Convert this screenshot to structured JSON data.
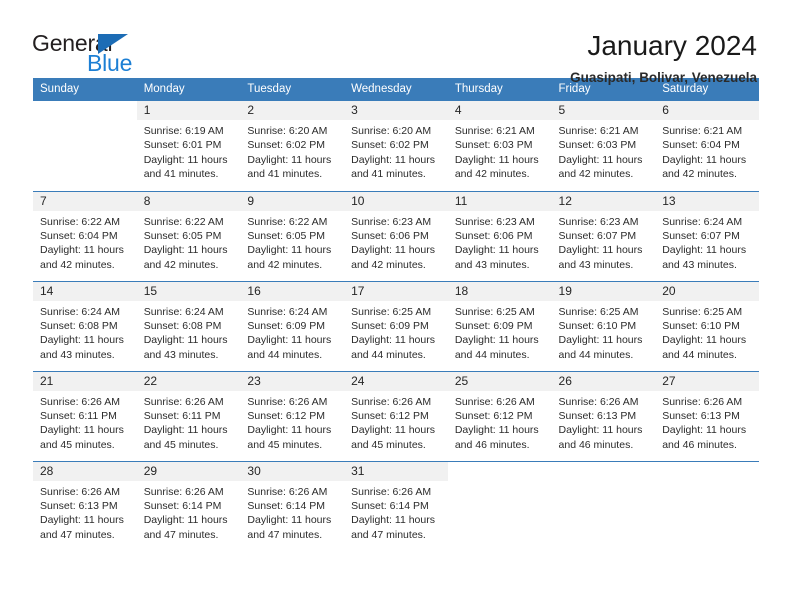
{
  "brand": {
    "name_top": "General",
    "name_bottom": "Blue",
    "triangle_color": "#1c6cb5",
    "blue_color": "#1c7fd4"
  },
  "header": {
    "title": "January 2024",
    "subtitle": "Guasipati, Bolivar, Venezuela"
  },
  "theme": {
    "header_bg": "#3a7cb9",
    "header_text": "#ffffff",
    "daynum_band_bg": "#f1f1f1",
    "row_separator": "#3a7cb9",
    "body_text": "#2b2b2b"
  },
  "calendar": {
    "weekday_headers": [
      "Sunday",
      "Monday",
      "Tuesday",
      "Wednesday",
      "Thursday",
      "Friday",
      "Saturday"
    ],
    "weeks": [
      [
        {
          "day": "",
          "sunrise": "",
          "sunset": "",
          "daylight_line1": "",
          "daylight_line2": ""
        },
        {
          "day": "1",
          "sunrise": "Sunrise: 6:19 AM",
          "sunset": "Sunset: 6:01 PM",
          "daylight_line1": "Daylight: 11 hours",
          "daylight_line2": "and 41 minutes."
        },
        {
          "day": "2",
          "sunrise": "Sunrise: 6:20 AM",
          "sunset": "Sunset: 6:02 PM",
          "daylight_line1": "Daylight: 11 hours",
          "daylight_line2": "and 41 minutes."
        },
        {
          "day": "3",
          "sunrise": "Sunrise: 6:20 AM",
          "sunset": "Sunset: 6:02 PM",
          "daylight_line1": "Daylight: 11 hours",
          "daylight_line2": "and 41 minutes."
        },
        {
          "day": "4",
          "sunrise": "Sunrise: 6:21 AM",
          "sunset": "Sunset: 6:03 PM",
          "daylight_line1": "Daylight: 11 hours",
          "daylight_line2": "and 42 minutes."
        },
        {
          "day": "5",
          "sunrise": "Sunrise: 6:21 AM",
          "sunset": "Sunset: 6:03 PM",
          "daylight_line1": "Daylight: 11 hours",
          "daylight_line2": "and 42 minutes."
        },
        {
          "day": "6",
          "sunrise": "Sunrise: 6:21 AM",
          "sunset": "Sunset: 6:04 PM",
          "daylight_line1": "Daylight: 11 hours",
          "daylight_line2": "and 42 minutes."
        }
      ],
      [
        {
          "day": "7",
          "sunrise": "Sunrise: 6:22 AM",
          "sunset": "Sunset: 6:04 PM",
          "daylight_line1": "Daylight: 11 hours",
          "daylight_line2": "and 42 minutes."
        },
        {
          "day": "8",
          "sunrise": "Sunrise: 6:22 AM",
          "sunset": "Sunset: 6:05 PM",
          "daylight_line1": "Daylight: 11 hours",
          "daylight_line2": "and 42 minutes."
        },
        {
          "day": "9",
          "sunrise": "Sunrise: 6:22 AM",
          "sunset": "Sunset: 6:05 PM",
          "daylight_line1": "Daylight: 11 hours",
          "daylight_line2": "and 42 minutes."
        },
        {
          "day": "10",
          "sunrise": "Sunrise: 6:23 AM",
          "sunset": "Sunset: 6:06 PM",
          "daylight_line1": "Daylight: 11 hours",
          "daylight_line2": "and 42 minutes."
        },
        {
          "day": "11",
          "sunrise": "Sunrise: 6:23 AM",
          "sunset": "Sunset: 6:06 PM",
          "daylight_line1": "Daylight: 11 hours",
          "daylight_line2": "and 43 minutes."
        },
        {
          "day": "12",
          "sunrise": "Sunrise: 6:23 AM",
          "sunset": "Sunset: 6:07 PM",
          "daylight_line1": "Daylight: 11 hours",
          "daylight_line2": "and 43 minutes."
        },
        {
          "day": "13",
          "sunrise": "Sunrise: 6:24 AM",
          "sunset": "Sunset: 6:07 PM",
          "daylight_line1": "Daylight: 11 hours",
          "daylight_line2": "and 43 minutes."
        }
      ],
      [
        {
          "day": "14",
          "sunrise": "Sunrise: 6:24 AM",
          "sunset": "Sunset: 6:08 PM",
          "daylight_line1": "Daylight: 11 hours",
          "daylight_line2": "and 43 minutes."
        },
        {
          "day": "15",
          "sunrise": "Sunrise: 6:24 AM",
          "sunset": "Sunset: 6:08 PM",
          "daylight_line1": "Daylight: 11 hours",
          "daylight_line2": "and 43 minutes."
        },
        {
          "day": "16",
          "sunrise": "Sunrise: 6:24 AM",
          "sunset": "Sunset: 6:09 PM",
          "daylight_line1": "Daylight: 11 hours",
          "daylight_line2": "and 44 minutes."
        },
        {
          "day": "17",
          "sunrise": "Sunrise: 6:25 AM",
          "sunset": "Sunset: 6:09 PM",
          "daylight_line1": "Daylight: 11 hours",
          "daylight_line2": "and 44 minutes."
        },
        {
          "day": "18",
          "sunrise": "Sunrise: 6:25 AM",
          "sunset": "Sunset: 6:09 PM",
          "daylight_line1": "Daylight: 11 hours",
          "daylight_line2": "and 44 minutes."
        },
        {
          "day": "19",
          "sunrise": "Sunrise: 6:25 AM",
          "sunset": "Sunset: 6:10 PM",
          "daylight_line1": "Daylight: 11 hours",
          "daylight_line2": "and 44 minutes."
        },
        {
          "day": "20",
          "sunrise": "Sunrise: 6:25 AM",
          "sunset": "Sunset: 6:10 PM",
          "daylight_line1": "Daylight: 11 hours",
          "daylight_line2": "and 44 minutes."
        }
      ],
      [
        {
          "day": "21",
          "sunrise": "Sunrise: 6:26 AM",
          "sunset": "Sunset: 6:11 PM",
          "daylight_line1": "Daylight: 11 hours",
          "daylight_line2": "and 45 minutes."
        },
        {
          "day": "22",
          "sunrise": "Sunrise: 6:26 AM",
          "sunset": "Sunset: 6:11 PM",
          "daylight_line1": "Daylight: 11 hours",
          "daylight_line2": "and 45 minutes."
        },
        {
          "day": "23",
          "sunrise": "Sunrise: 6:26 AM",
          "sunset": "Sunset: 6:12 PM",
          "daylight_line1": "Daylight: 11 hours",
          "daylight_line2": "and 45 minutes."
        },
        {
          "day": "24",
          "sunrise": "Sunrise: 6:26 AM",
          "sunset": "Sunset: 6:12 PM",
          "daylight_line1": "Daylight: 11 hours",
          "daylight_line2": "and 45 minutes."
        },
        {
          "day": "25",
          "sunrise": "Sunrise: 6:26 AM",
          "sunset": "Sunset: 6:12 PM",
          "daylight_line1": "Daylight: 11 hours",
          "daylight_line2": "and 46 minutes."
        },
        {
          "day": "26",
          "sunrise": "Sunrise: 6:26 AM",
          "sunset": "Sunset: 6:13 PM",
          "daylight_line1": "Daylight: 11 hours",
          "daylight_line2": "and 46 minutes."
        },
        {
          "day": "27",
          "sunrise": "Sunrise: 6:26 AM",
          "sunset": "Sunset: 6:13 PM",
          "daylight_line1": "Daylight: 11 hours",
          "daylight_line2": "and 46 minutes."
        }
      ],
      [
        {
          "day": "28",
          "sunrise": "Sunrise: 6:26 AM",
          "sunset": "Sunset: 6:13 PM",
          "daylight_line1": "Daylight: 11 hours",
          "daylight_line2": "and 47 minutes."
        },
        {
          "day": "29",
          "sunrise": "Sunrise: 6:26 AM",
          "sunset": "Sunset: 6:14 PM",
          "daylight_line1": "Daylight: 11 hours",
          "daylight_line2": "and 47 minutes."
        },
        {
          "day": "30",
          "sunrise": "Sunrise: 6:26 AM",
          "sunset": "Sunset: 6:14 PM",
          "daylight_line1": "Daylight: 11 hours",
          "daylight_line2": "and 47 minutes."
        },
        {
          "day": "31",
          "sunrise": "Sunrise: 6:26 AM",
          "sunset": "Sunset: 6:14 PM",
          "daylight_line1": "Daylight: 11 hours",
          "daylight_line2": "and 47 minutes."
        },
        {
          "day": "",
          "sunrise": "",
          "sunset": "",
          "daylight_line1": "",
          "daylight_line2": ""
        },
        {
          "day": "",
          "sunrise": "",
          "sunset": "",
          "daylight_line1": "",
          "daylight_line2": ""
        },
        {
          "day": "",
          "sunrise": "",
          "sunset": "",
          "daylight_line1": "",
          "daylight_line2": ""
        }
      ]
    ]
  }
}
